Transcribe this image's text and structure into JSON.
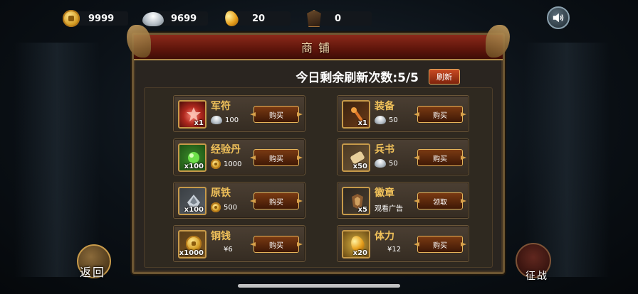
{
  "resources": [
    {
      "icon": "copper-coin-icon",
      "value": "9999"
    },
    {
      "icon": "silver-ingot-icon",
      "value": "9699"
    },
    {
      "icon": "gold-egg-icon",
      "value": "20"
    },
    {
      "icon": "emblem-icon",
      "value": "0"
    }
  ],
  "shop": {
    "title": "商铺",
    "refresh_text": "今日剩余刷新次数:5/5",
    "refresh_button": "刷新"
  },
  "items": [
    {
      "name": "军符",
      "count": "x1",
      "price": "100",
      "currency": "silver-ingot-icon",
      "action": "购买",
      "icon": "army-tally-icon"
    },
    {
      "name": "装备",
      "count": "x1",
      "price": "50",
      "currency": "silver-ingot-icon",
      "action": "购买",
      "icon": "equipment-icon"
    },
    {
      "name": "经验丹",
      "count": "x100",
      "price": "1000",
      "currency": "copper-coin-icon",
      "action": "购买",
      "icon": "exp-pill-icon"
    },
    {
      "name": "兵书",
      "count": "x50",
      "price": "50",
      "currency": "silver-ingot-icon",
      "action": "购买",
      "icon": "war-book-icon"
    },
    {
      "name": "原铁",
      "count": "x100",
      "price": "500",
      "currency": "copper-coin-icon",
      "action": "购买",
      "icon": "raw-iron-icon"
    },
    {
      "name": "徽章",
      "count": "x5",
      "price": "观看广告",
      "currency": "",
      "action": "领取",
      "icon": "badge-icon"
    },
    {
      "name": "铜钱",
      "count": "x1000",
      "price": "¥6",
      "currency": "",
      "action": "购买",
      "icon": "copper-coin-icon"
    },
    {
      "name": "体力",
      "count": "x20",
      "price": "¥12",
      "currency": "",
      "action": "购买",
      "icon": "stamina-icon"
    }
  ],
  "nav": {
    "return_label": "返回",
    "battle_label": "征战"
  },
  "colors": {
    "item_name": "#f0c15a",
    "header_red": "#8c2a1a",
    "frame_gold": "#c79a4a"
  }
}
